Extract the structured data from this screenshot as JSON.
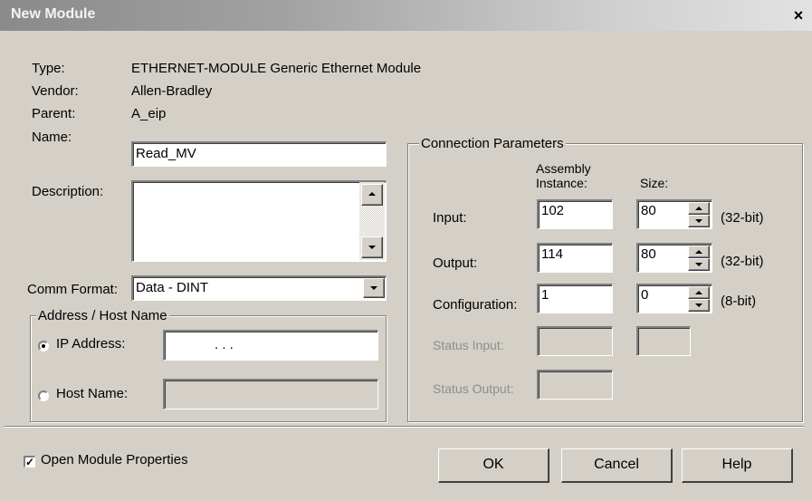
{
  "window": {
    "title": "New Module",
    "close_symbol": "×"
  },
  "info": {
    "type_label": "Type:",
    "type_value": "ETHERNET-MODULE Generic Ethernet Module",
    "vendor_label": "Vendor:",
    "vendor_value": "Allen-Bradley",
    "parent_label": "Parent:",
    "parent_value": "A_eip"
  },
  "name": {
    "label": "Name:",
    "value": "Read_MV"
  },
  "description": {
    "label": "Description:",
    "value": ""
  },
  "comm_format": {
    "label": "Comm Format:",
    "value": "Data - DINT"
  },
  "address": {
    "group_title": "Address / Host Name",
    "ip_label": "IP Address:",
    "ip_value": ".          .          .",
    "host_label": "Host Name:",
    "host_value": "",
    "selected": "IP Address"
  },
  "connection": {
    "group_title": "Connection Parameters",
    "col_assembly_line1": "Assembly",
    "col_assembly_line2": "Instance:",
    "col_size": "Size:",
    "input": {
      "label": "Input:",
      "instance": "102",
      "size": "80",
      "unit": "(32-bit)"
    },
    "output": {
      "label": "Output:",
      "instance": "114",
      "size": "80",
      "unit": "(32-bit)"
    },
    "configuration": {
      "label": "Configuration:",
      "instance": "1",
      "size": "0",
      "unit": "(8-bit)"
    },
    "status_input": {
      "label": "Status Input:",
      "instance": "",
      "size": ""
    },
    "status_output": {
      "label": "Status Output:",
      "instance": ""
    }
  },
  "open_module_properties": {
    "label": "Open Module Properties",
    "checked": true,
    "check_symbol": "✓"
  },
  "buttons": {
    "ok": "OK",
    "cancel": "Cancel",
    "help": "Help"
  }
}
